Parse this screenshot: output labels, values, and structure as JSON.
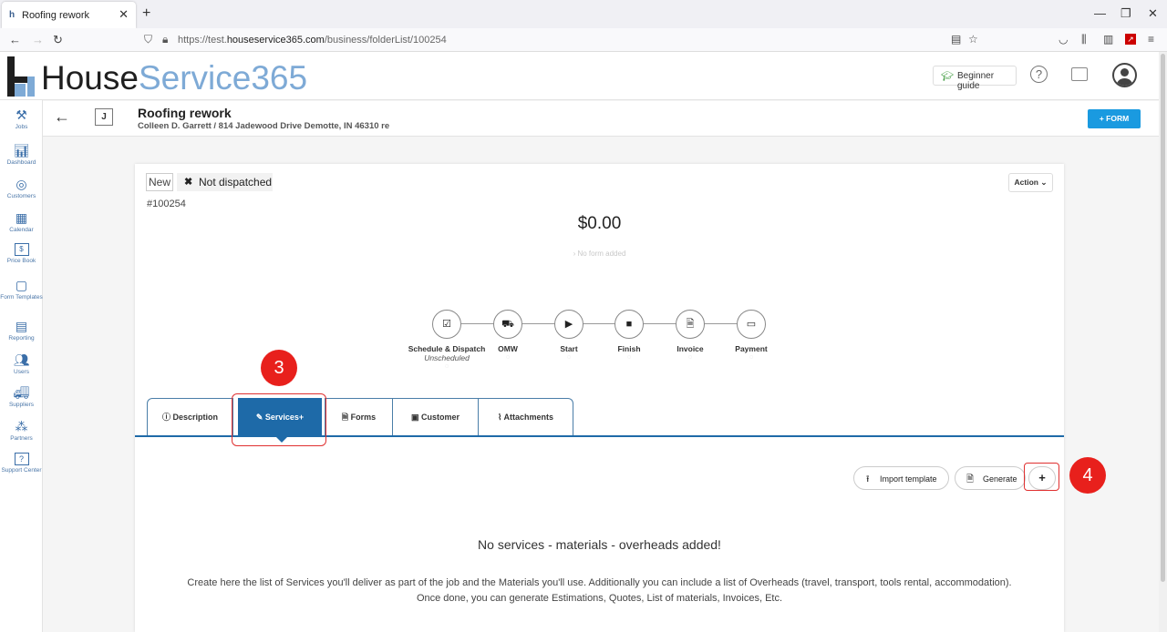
{
  "browser": {
    "tab_title": "Roofing rework",
    "url_prefix": "https://test.",
    "url_domain": "houseservice365.com",
    "url_path": "/business/folderList/100254"
  },
  "app": {
    "logo_part1": "House",
    "logo_part2": "Service365",
    "beginner_guide": "Beginner guide",
    "help": "?"
  },
  "sidebar": {
    "items": [
      {
        "label": "Jobs",
        "icon": "tools-icon"
      },
      {
        "label": "Dashboard",
        "icon": "bar-chart-icon"
      },
      {
        "label": "Customers",
        "icon": "customers-icon"
      },
      {
        "label": "Calendar",
        "icon": "calendar-icon"
      },
      {
        "label": "Price Book",
        "icon": "price-book-icon"
      },
      {
        "label": "Form Templates",
        "icon": "form-templates-icon"
      },
      {
        "label": "Reporting",
        "icon": "reporting-icon"
      },
      {
        "label": "Users",
        "icon": "users-icon"
      },
      {
        "label": "Suppliers",
        "icon": "truck-icon"
      },
      {
        "label": "Partners",
        "icon": "partners-icon"
      },
      {
        "label": "Support Center",
        "icon": "support-icon"
      }
    ]
  },
  "job": {
    "initial": "J",
    "title": "Roofing rework",
    "subtitle": "Colleen D. Garrett / 814 Jadewood Drive Demotte, IN 46310 re",
    "form_button": "+ FORM",
    "status_new": "New",
    "status_dispatch": "Not dispatched",
    "number": "#100254",
    "action_button": "Action",
    "amount": "$0.00",
    "no_form": "No form added"
  },
  "steps": [
    {
      "label": "Schedule & Dispatch",
      "sub": "Unscheduled"
    },
    {
      "label": "OMW",
      "sub": ""
    },
    {
      "label": "Start",
      "sub": ""
    },
    {
      "label": "Finish",
      "sub": ""
    },
    {
      "label": "Invoice",
      "sub": ""
    },
    {
      "label": "Payment",
      "sub": ""
    }
  ],
  "tabs": [
    {
      "label": "Description"
    },
    {
      "label": "Services+"
    },
    {
      "label": "Forms"
    },
    {
      "label": "Customer"
    },
    {
      "label": "Attachments"
    }
  ],
  "toolbar": {
    "import_template": "Import template",
    "generate": "Generate",
    "add": "+"
  },
  "empty_state": {
    "title": "No services - materials - overheads added!",
    "line1": "Create here the list of Services you'll deliver as part of the job and the Materials you'll use. Additionally you can include a list of Overheads (travel, transport, tools rental, accommodation).",
    "line2": "Once done, you can generate Estimations, Quotes, List of materials, Invoices, Etc."
  },
  "annotations": {
    "step3": "3",
    "step4": "4"
  },
  "colors": {
    "primary": "#1e6aa8",
    "form_button": "#1a9ae0",
    "annotation": "#e8201c"
  }
}
